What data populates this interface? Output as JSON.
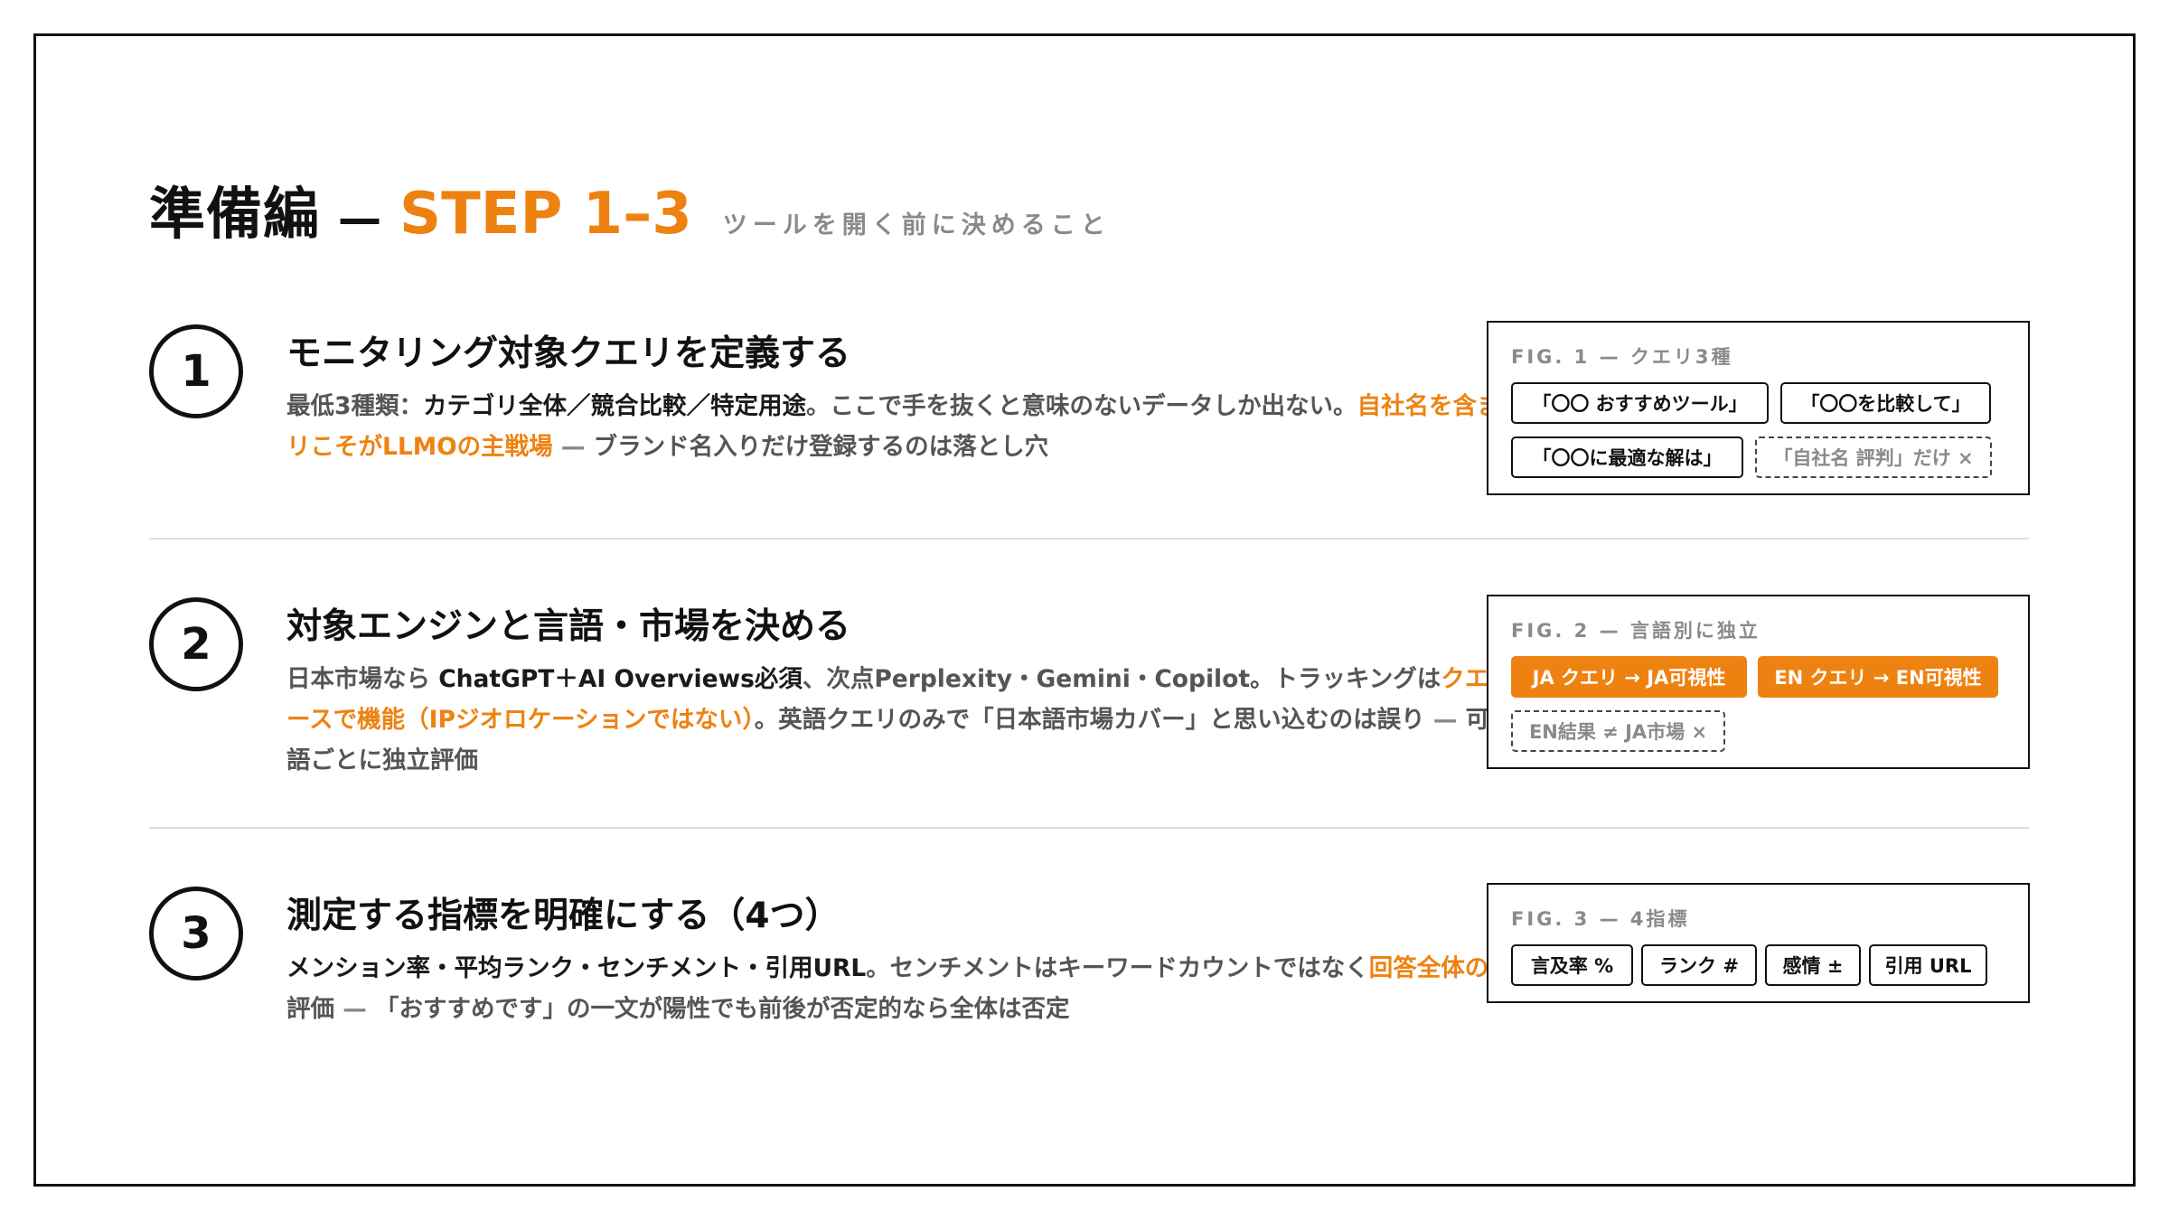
{
  "header": {
    "title": "準備編",
    "dash": "—",
    "step": "STEP 1–3",
    "subtitle": "ツールを開く前に決めること"
  },
  "steps": [
    {
      "number": "1",
      "title": "モニタリング対象クエリを定義する",
      "body": {
        "p1": "最低3種類：",
        "s1": "カテゴリ全体／競合比較／特定用途",
        "p2": "。ここで手を抜くと意味のないデータしか出ない。",
        "h1": "自社名を含まないクエリこそがLLMOの主戦場",
        "d1": " — ",
        "p3": "ブランド名入りだけ登録するのは落とし穴"
      },
      "figure": {
        "caption": "FIG. 1 — クエリ3種",
        "chips": [
          "「〇〇 おすすめツール」",
          "「〇〇を比較して」",
          "「〇〇に最適な解は」",
          "「自社名 評判」だけ ×"
        ]
      }
    },
    {
      "number": "2",
      "title": "対象エンジンと言語・市場を決める",
      "body": {
        "p1": "日本市場なら ",
        "s1": "ChatGPT＋AI Overviews必須",
        "p2": "、次点Perplexity・Gemini・Copilot。トラッキングは",
        "h1": "クエリ言語ベースで機能（IPジオロケーションではない）",
        "p3": "。英語クエリのみで「日本語市場カバー」と思い込むのは誤り",
        "d1": " — ",
        "p4": "可視性は言語ごとに独立評価"
      },
      "figure": {
        "caption": "FIG. 2 — 言語別に独立",
        "chips": [
          "JA クエリ → JA可視性",
          "EN クエリ → EN可視性",
          "EN結果 ≠ JA市場 ×"
        ]
      }
    },
    {
      "number": "3",
      "title": "測定する指標を明確にする（4つ）",
      "body": {
        "s1": "メンション率・平均ランク・センチメント・引用URL",
        "p1": "。センチメントはキーワードカウントではなく",
        "h1": "回答全体のトーン",
        "p2": "で評価",
        "d1": " — ",
        "p3": "「おすすめです」の一文が陽性でも前後が否定的なら全体は否定"
      },
      "figure": {
        "caption": "FIG. 3 — 4指標",
        "chips": [
          "言及率 %",
          "ランク #",
          "感情 ±",
          "引用 URL"
        ]
      }
    }
  ],
  "colors": {
    "accent": "#ee8211",
    "text": "#1a1a1a",
    "muted": "#8a8a8a",
    "rule": "#dcdcdc"
  }
}
